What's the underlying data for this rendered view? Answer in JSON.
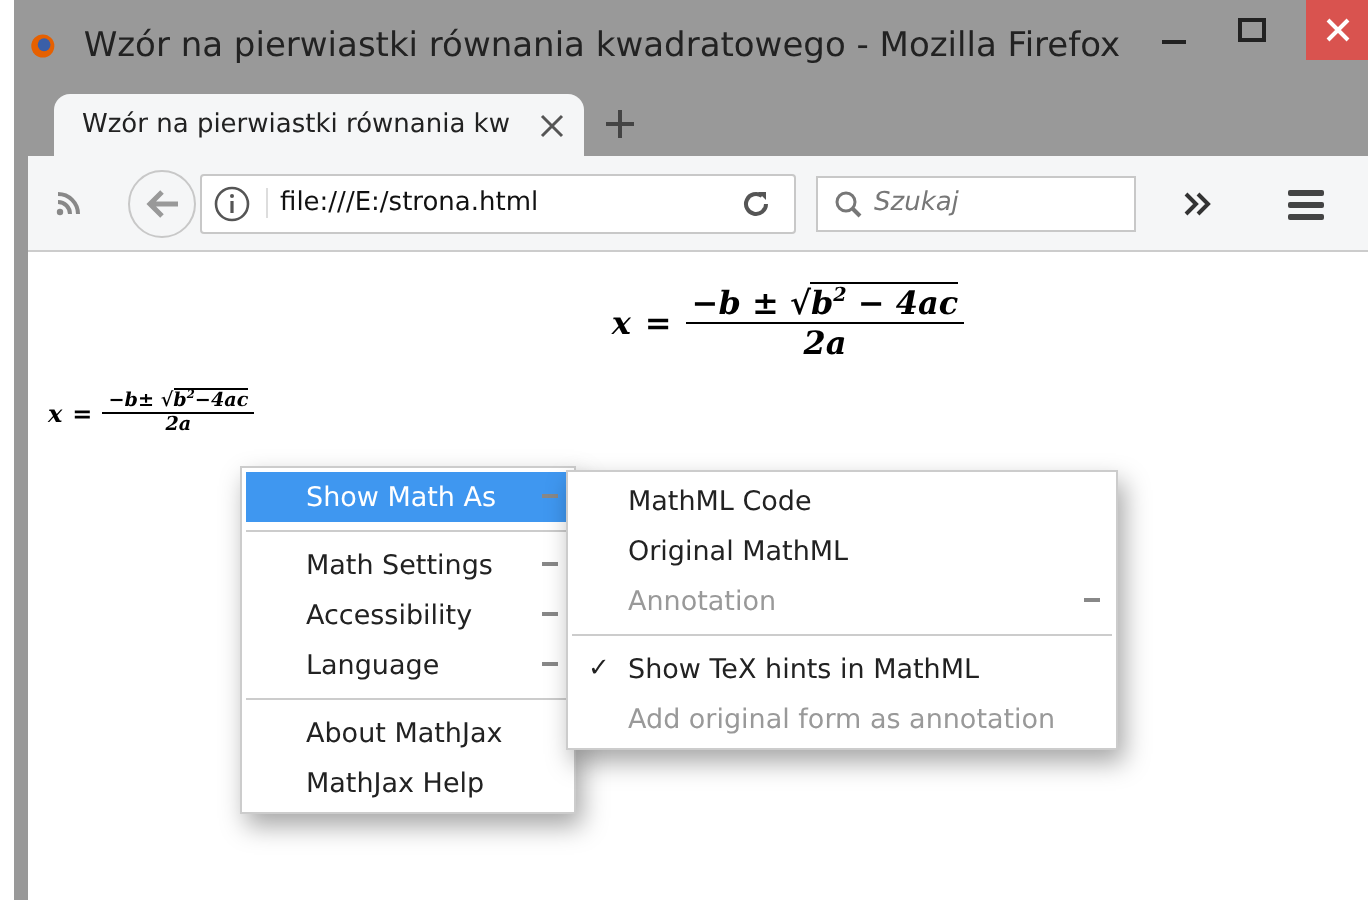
{
  "window": {
    "title": "Wzór na pierwiastki równania kwadratowego - Mozilla Firefox"
  },
  "tabs": [
    {
      "label": "Wzór na pierwiastki równania kw",
      "selected": true
    }
  ],
  "toolbar": {
    "url": "file:///E:/strona.html",
    "search_placeholder": "Szukaj"
  },
  "formulas": [
    {
      "kind": "display",
      "variable": "x",
      "equals": "=",
      "numerator": "−b ±",
      "radical": "√",
      "radicand": "b",
      "exponent": "2",
      "radicand_rest": " − 4ac",
      "denominator": "2a"
    },
    {
      "kind": "inline",
      "variable": "x",
      "equals": "=",
      "numerator": "−b±",
      "radical": "√",
      "radicand": "b",
      "exponent": "2",
      "radicand_rest": "−4ac",
      "denominator": "2a"
    }
  ],
  "context_menu": {
    "items": [
      {
        "kind": "item",
        "label": "Show Math As",
        "selected": true,
        "submenu": true
      },
      {
        "kind": "separator"
      },
      {
        "kind": "item",
        "label": "Math Settings",
        "selected": false,
        "submenu": true
      },
      {
        "kind": "item",
        "label": "Accessibility",
        "selected": false,
        "submenu": true
      },
      {
        "kind": "item",
        "label": "Language",
        "selected": false,
        "submenu": true
      },
      {
        "kind": "separator"
      },
      {
        "kind": "item",
        "label": "About MathJax",
        "selected": false,
        "submenu": false
      },
      {
        "kind": "item",
        "label": "MathJax Help",
        "selected": false,
        "submenu": false
      }
    ]
  },
  "submenu": {
    "check_symbol": "✓",
    "items": [
      {
        "kind": "item",
        "label": "MathML Code",
        "disabled": false,
        "checked": false,
        "submenu": false
      },
      {
        "kind": "item",
        "label": "Original MathML",
        "disabled": false,
        "checked": false,
        "submenu": false
      },
      {
        "kind": "item",
        "label": "Annotation",
        "disabled": true,
        "checked": false,
        "submenu": true
      },
      {
        "kind": "separator"
      },
      {
        "kind": "item",
        "label": "Show TeX hints in MathML",
        "disabled": false,
        "checked": true,
        "submenu": false
      },
      {
        "kind": "item",
        "label": "Add original form as annotation",
        "disabled": true,
        "checked": false,
        "submenu": false
      }
    ]
  }
}
